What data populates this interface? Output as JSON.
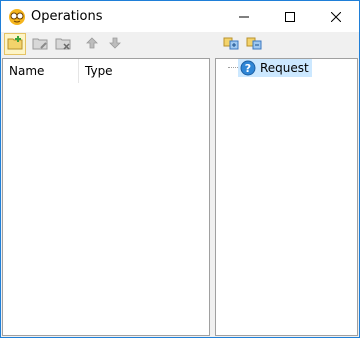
{
  "window": {
    "title": "Operations",
    "app_icon": "glasses-icon"
  },
  "titlebar_buttons": [
    "minimize-icon",
    "maximize-icon",
    "close-icon"
  ],
  "toolbar_left": [
    {
      "name": "add-operation-button",
      "icon": "folder-add-icon",
      "active": true
    },
    {
      "name": "edit-operation-button",
      "icon": "folder-edit-icon",
      "active": false
    },
    {
      "name": "delete-operation-button",
      "icon": "folder-delete-icon",
      "active": false
    },
    {
      "name": "move-up-button",
      "icon": "arrow-up-icon",
      "active": false
    },
    {
      "name": "move-down-button",
      "icon": "arrow-down-icon",
      "active": false
    }
  ],
  "toolbar_right": [
    {
      "name": "expand-tree-button",
      "icon": "tree-expand-icon"
    },
    {
      "name": "collapse-tree-button",
      "icon": "tree-collapse-icon"
    }
  ],
  "list": {
    "columns": [
      "Name",
      "Type"
    ]
  },
  "tree": {
    "root": {
      "label": "Request",
      "icon": "help-icon"
    }
  },
  "colors": {
    "accent": "#1f7fd8",
    "selection": "#cce8ff"
  }
}
